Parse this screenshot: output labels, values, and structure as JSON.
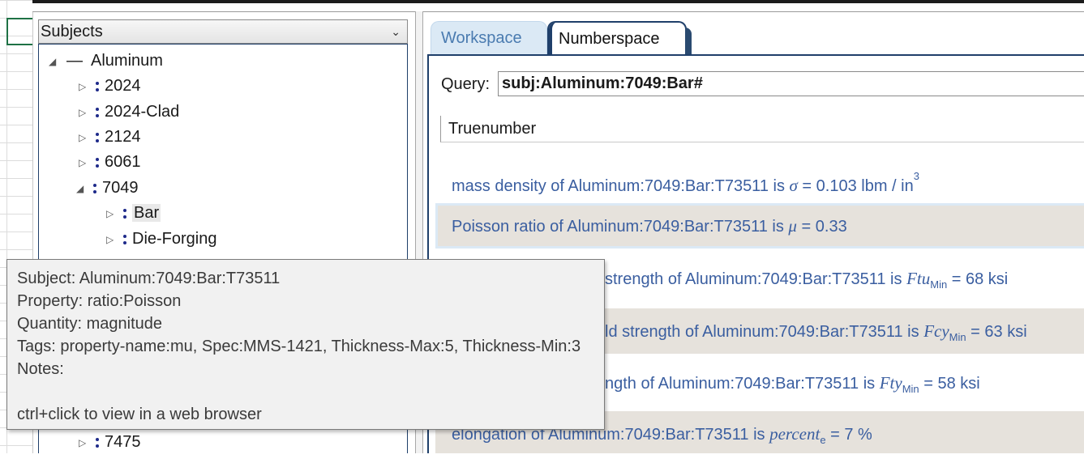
{
  "subjects_panel": {
    "dropdown_label": "Subjects",
    "tree": {
      "root": "Aluminum",
      "items": [
        {
          "label": "2024",
          "expanded": false
        },
        {
          "label": "2024-Clad",
          "expanded": false
        },
        {
          "label": "2124",
          "expanded": false
        },
        {
          "label": "6061",
          "expanded": false
        },
        {
          "label": "7049",
          "expanded": true
        },
        {
          "label": "Bar",
          "expanded": false
        },
        {
          "label": "Die-Forging",
          "expanded": false
        },
        {
          "label": "7475",
          "expanded": false
        }
      ]
    }
  },
  "tabs": {
    "workspace": "Workspace",
    "numberspace": "Numberspace",
    "active": "Numberspace"
  },
  "query": {
    "label": "Query:",
    "value": "subj:Aluminum:7049:Bar#"
  },
  "results": {
    "column_header": "Truenumber",
    "rows": [
      {
        "text": "mass density of Aluminum:7049:Bar:T73511 is ",
        "symbol": "σ",
        "sub": "",
        "rest": " = 0.103 lbm / in",
        "sup": "3"
      },
      {
        "text": "Poisson ratio of Aluminum:7049:Bar:T73511 is ",
        "symbol": "μ",
        "sub": "",
        "rest": " = 0.33",
        "sup": ""
      },
      {
        "text": "strength of Aluminum:7049:Bar:T73511 is ",
        "symbol": "Ftu",
        "sub": "Min",
        "rest": " = 68 ksi",
        "sup": ""
      },
      {
        "text": "ld strength of Aluminum:7049:Bar:T73511 is ",
        "symbol": "Fcy",
        "sub": "Min",
        "rest": " = 63 ksi",
        "sup": ""
      },
      {
        "text": "ngth of Aluminum:7049:Bar:T73511 is ",
        "symbol": "Fty",
        "sub": "Min",
        "rest": " = 58 ksi",
        "sup": ""
      },
      {
        "text": "elongation of Aluminum:7049:Bar:T73511 is ",
        "symbol": "percent",
        "sub": "e",
        "rest": " = 7 %",
        "sup": ""
      }
    ]
  },
  "tooltip": {
    "subject": "Subject:  Aluminum:7049:Bar:T73511",
    "property": "Property:  ratio:Poisson",
    "quantity": "Quantity:  magnitude",
    "tags": "Tags:  property-name:mu, Spec:MMS-1421, Thickness-Max:5, Thickness-Min:3",
    "notes": "Notes:",
    "hint": "ctrl+click to view in a web browser"
  },
  "colors": {
    "accent_dark": "#1f3f6a",
    "result_text": "#3a5ea0",
    "alt_row": "#e6e2dc",
    "workspace_tab": "#dbe9f5"
  }
}
